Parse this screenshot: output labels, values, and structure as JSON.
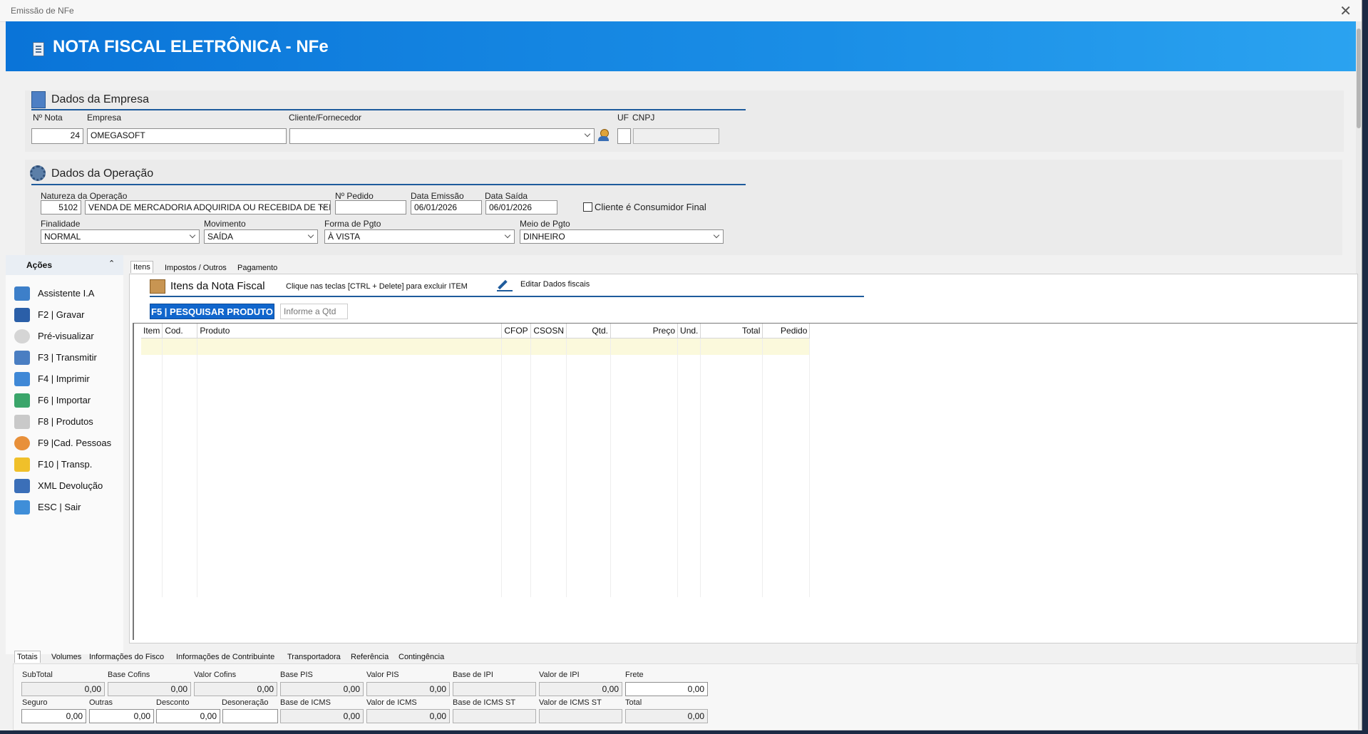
{
  "window": {
    "title": "Emissão de NFe",
    "close": "✕"
  },
  "banner": {
    "title": "NOTA FISCAL ELETRÔNICA - NFe"
  },
  "empresa": {
    "title": "Dados da Empresa",
    "labels": {
      "nota": "Nº Nota",
      "empresa": "Empresa",
      "cliente": "Cliente/Fornecedor",
      "uf": "UF",
      "cnpj": "CNPJ"
    },
    "values": {
      "nota": "24",
      "empresa": "OMEGASOFT",
      "cliente": "",
      "uf": "",
      "cnpj": ""
    }
  },
  "operacao": {
    "title": "Dados da Operação",
    "labels": {
      "natureza": "Natureza da Operação",
      "pedido": "Nº Pedido",
      "emissao": "Data Emissão",
      "saida": "Data Saída",
      "consumidor": "Cliente é Consumidor Final",
      "finalidade": "Finalidade",
      "movimento": "Movimento",
      "forma": "Forma de Pgto",
      "meio": "Meio de Pgto"
    },
    "values": {
      "cfop": "5102",
      "natureza": "VENDA DE MERCADORIA ADQUIRIDA OU RECEBIDA DE TERC",
      "pedido": "",
      "emissao": "06/01/2026",
      "saida": "06/01/2026",
      "finalidade": "NORMAL",
      "movimento": "SAÍDA",
      "forma": "À VISTA",
      "meio": "DINHEIRO"
    }
  },
  "sidebar": {
    "title": "Ações",
    "items": [
      {
        "label": "Assistente I.A",
        "icon": "assistant-icon"
      },
      {
        "label": "F2 | Gravar",
        "icon": "save-icon"
      },
      {
        "label": "Pré-visualizar",
        "icon": "preview-icon"
      },
      {
        "label": "F3 | Transmitir",
        "icon": "transmit-icon"
      },
      {
        "label": "F4 | Imprimir",
        "icon": "print-icon"
      },
      {
        "label": "F6 | Importar",
        "icon": "import-icon"
      },
      {
        "label": "F8 | Produtos",
        "icon": "products-icon"
      },
      {
        "label": "F9 |Cad. Pessoas",
        "icon": "people-icon"
      },
      {
        "label": "F10 | Transp.",
        "icon": "truck-icon"
      },
      {
        "label": "XML Devolução",
        "icon": "xml-icon"
      },
      {
        "label": "ESC | Sair",
        "icon": "exit-icon"
      }
    ]
  },
  "tabs": [
    "Itens",
    "Impostos  / Outros",
    "Pagamento"
  ],
  "itens": {
    "title": "Itens da Nota Fiscal",
    "hint": "Clique nas teclas [CTRL + Delete] para excluir ITEM",
    "edit_link": "Editar Dados fiscais",
    "search_button": "F5 | PESQUISAR PRODUTO",
    "qty_placeholder": "Informe a Qtd",
    "columns": [
      "Item",
      "Cod.",
      "Produto",
      "CFOP",
      "CSOSN",
      "Qtd.",
      "Preço",
      "Und.",
      "Total",
      "Pedido"
    ]
  },
  "bottom_tabs": [
    "Totais",
    "Volumes",
    "Informações do Fisco",
    "Informações de Contribuinte",
    "Transportadora",
    "Referência",
    "Contingência"
  ],
  "totais": {
    "row1": [
      {
        "label": "SubTotal",
        "value": "0,00"
      },
      {
        "label": "Base Cofins",
        "value": "0,00"
      },
      {
        "label": "Valor Cofins",
        "value": "0,00"
      },
      {
        "label": "Base PIS",
        "value": "0,00"
      },
      {
        "label": "Valor PIS",
        "value": "0,00"
      },
      {
        "label": "Base de IPI",
        "value": ""
      },
      {
        "label": "Valor de IPI",
        "value": "0,00"
      },
      {
        "label": "Frete",
        "value": "0,00"
      }
    ],
    "row2": [
      {
        "label": "Seguro",
        "value": "0,00"
      },
      {
        "label": "Outras",
        "value": "0,00"
      },
      {
        "label": "Desconto",
        "value": "0,00"
      },
      {
        "label": "Desoneração",
        "value": ""
      },
      {
        "label": "Base de ICMS",
        "value": "0,00"
      },
      {
        "label": "Valor de ICMS",
        "value": "0,00"
      },
      {
        "label": "Base de ICMS ST",
        "value": ""
      },
      {
        "label": "Valor de ICMS ST",
        "value": ""
      },
      {
        "label": "Total",
        "value": "0,00"
      }
    ]
  }
}
